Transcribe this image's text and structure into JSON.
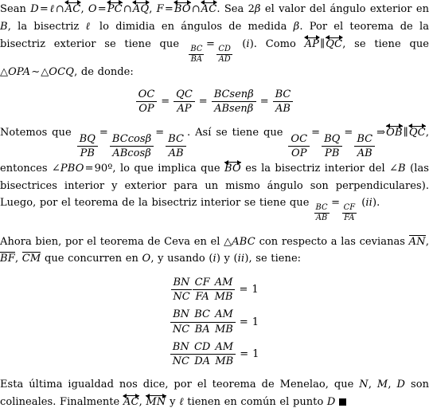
{
  "document": {
    "language": "es",
    "type": "math-proof",
    "paragraphs": [
      {
        "id": "p1",
        "segments": [
          {
            "t": "text",
            "v": "Sean "
          },
          {
            "t": "mi",
            "v": "D"
          },
          {
            "t": "op",
            "v": "="
          },
          {
            "t": "mi",
            "v": "ℓ"
          },
          {
            "t": "op",
            "v": "∩"
          },
          {
            "t": "line",
            "v": "AC"
          },
          {
            "t": "text",
            "v": ", "
          },
          {
            "t": "mi",
            "v": "O"
          },
          {
            "t": "op",
            "v": "="
          },
          {
            "t": "line",
            "v": "PC"
          },
          {
            "t": "op",
            "v": "∩"
          },
          {
            "t": "line",
            "v": "AQ"
          },
          {
            "t": "text",
            "v": ", "
          },
          {
            "t": "mi",
            "v": "F"
          },
          {
            "t": "op",
            "v": "="
          },
          {
            "t": "line",
            "v": "BO"
          },
          {
            "t": "op",
            "v": "∩"
          },
          {
            "t": "line",
            "v": "AC"
          },
          {
            "t": "text",
            "v": ". Sea 2"
          },
          {
            "t": "mi",
            "v": "β"
          },
          {
            "t": "text",
            "v": " el valor del ángulo exterior en "
          },
          {
            "t": "mi",
            "v": "B"
          },
          {
            "t": "text",
            "v": ", la bisectriz "
          },
          {
            "t": "mi",
            "v": "ℓ"
          },
          {
            "t": "text",
            "v": " lo dimidia en ángulos de medida "
          },
          {
            "t": "mi",
            "v": "β"
          },
          {
            "t": "text",
            "v": ". Por el teorema de la bisectriz exterior se tiene que "
          },
          {
            "t": "fracin",
            "num": "BC",
            "den": "BA"
          },
          {
            "t": "op",
            "v": "="
          },
          {
            "t": "fracin",
            "num": "CD",
            "den": "AD"
          },
          {
            "t": "text",
            "v": " ("
          },
          {
            "t": "mi",
            "v": "i"
          },
          {
            "t": "text",
            "v": "). Como "
          },
          {
            "t": "line",
            "v": "AP"
          },
          {
            "t": "op",
            "v": "∥"
          },
          {
            "t": "line",
            "v": "QC"
          },
          {
            "t": "text",
            "v": ", se tiene que △"
          },
          {
            "t": "mi",
            "v": "OPA"
          },
          {
            "t": "op",
            "v": "∼"
          },
          {
            "t": "text",
            "v": "△"
          },
          {
            "t": "mi",
            "v": "OCQ"
          },
          {
            "t": "text",
            "v": ", de donde:"
          }
        ]
      },
      {
        "id": "p3",
        "segments": [
          {
            "t": "text",
            "v": "Notemos que "
          },
          {
            "t": "frac",
            "num": "BQ",
            "den": "PB"
          },
          {
            "t": "op",
            "v": "="
          },
          {
            "t": "frac",
            "num": "BCcosβ",
            "den": "ABcosβ"
          },
          {
            "t": "op",
            "v": "="
          },
          {
            "t": "frac",
            "num": "BC",
            "den": "AB"
          },
          {
            "t": "text",
            "v": ". Así se tiene que "
          },
          {
            "t": "frac",
            "num": "OC",
            "den": "OP"
          },
          {
            "t": "op",
            "v": "="
          },
          {
            "t": "frac",
            "num": "BQ",
            "den": "PB"
          },
          {
            "t": "op",
            "v": "="
          },
          {
            "t": "frac",
            "num": "BC",
            "den": "AB"
          },
          {
            "t": "op",
            "v": "⇒"
          },
          {
            "t": "line",
            "v": "OB"
          },
          {
            "t": "op",
            "v": "∥"
          },
          {
            "t": "line",
            "v": "QC"
          },
          {
            "t": "text",
            "v": ", entonces ∠"
          },
          {
            "t": "mi",
            "v": "PBO"
          },
          {
            "t": "op",
            "v": "="
          },
          {
            "t": "text",
            "v": "90º, lo que implica que "
          },
          {
            "t": "line",
            "v": "BO"
          },
          {
            "t": "text",
            "v": " es la bisectriz interior del ∠"
          },
          {
            "t": "mi",
            "v": "B"
          },
          {
            "t": "text",
            "v": " (las bisectrices interior y exterior para un mismo ángulo son perpendiculares). Luego, por el teorema de la bisectriz interior se tiene que "
          },
          {
            "t": "fracin",
            "num": "BC",
            "den": "AB"
          },
          {
            "t": "op",
            "v": "="
          },
          {
            "t": "fracin",
            "num": "CF",
            "den": "FA"
          },
          {
            "t": "text",
            "v": " ("
          },
          {
            "t": "mi",
            "v": "ii"
          },
          {
            "t": "text",
            "v": ")."
          }
        ]
      },
      {
        "id": "p4",
        "segments": [
          {
            "t": "text",
            "v": "Ahora bien, por el teorema de Ceva en el △"
          },
          {
            "t": "mi",
            "v": "ABC"
          },
          {
            "t": "text",
            "v": " con respecto a las cevianas "
          },
          {
            "t": "seg",
            "v": "AN"
          },
          {
            "t": "text",
            "v": ", "
          },
          {
            "t": "seg",
            "v": "BF"
          },
          {
            "t": "text",
            "v": ", "
          },
          {
            "t": "seg",
            "v": "CM"
          },
          {
            "t": "text",
            "v": " que concurren en "
          },
          {
            "t": "mi",
            "v": "O"
          },
          {
            "t": "text",
            "v": ", y usando ("
          },
          {
            "t": "mi",
            "v": "i"
          },
          {
            "t": "text",
            "v": ") y ("
          },
          {
            "t": "mi",
            "v": "ii"
          },
          {
            "t": "text",
            "v": "), se tiene:"
          }
        ]
      },
      {
        "id": "p5",
        "segments": [
          {
            "t": "text",
            "v": "Esta última igualdad nos dice, por el teorema de Menelao, que "
          },
          {
            "t": "mi",
            "v": "N"
          },
          {
            "t": "text",
            "v": ", "
          },
          {
            "t": "mi",
            "v": "M"
          },
          {
            "t": "text",
            "v": ", "
          },
          {
            "t": "mi",
            "v": "D"
          },
          {
            "t": "text",
            "v": " son colineales. Finalmente "
          },
          {
            "t": "line",
            "v": "AC"
          },
          {
            "t": "text",
            "v": ", "
          },
          {
            "t": "line",
            "v": "MN"
          },
          {
            "t": "text",
            "v": " y "
          },
          {
            "t": "mi",
            "v": "ℓ"
          },
          {
            "t": "text",
            "v": " tienen en común el punto "
          },
          {
            "t": "mi",
            "v": "D"
          },
          {
            "t": "qed",
            "v": "■"
          }
        ]
      }
    ],
    "display_equations": [
      {
        "id": "eq1",
        "parts": [
          {
            "t": "frac",
            "num": "OC",
            "den": "OP"
          },
          {
            "t": "op",
            "v": "="
          },
          {
            "t": "frac",
            "num": "QC",
            "den": "AP"
          },
          {
            "t": "op",
            "v": "="
          },
          {
            "t": "frac",
            "num": "BCsenβ",
            "den": "ABsenβ"
          },
          {
            "t": "op",
            "v": "="
          },
          {
            "t": "frac",
            "num": "BC",
            "den": "AB"
          }
        ]
      },
      {
        "id": "eq2",
        "parts": [
          {
            "t": "frac",
            "num": "BN",
            "den": "NC"
          },
          {
            "t": "frac",
            "num": "CF",
            "den": "FA"
          },
          {
            "t": "frac",
            "num": "AM",
            "den": "MB"
          },
          {
            "t": "op",
            "v": "="
          },
          {
            "t": "mn",
            "v": "1"
          }
        ]
      },
      {
        "id": "eq3",
        "parts": [
          {
            "t": "frac",
            "num": "BN",
            "den": "NC"
          },
          {
            "t": "frac",
            "num": "BC",
            "den": "BA"
          },
          {
            "t": "frac",
            "num": "AM",
            "den": "MB"
          },
          {
            "t": "op",
            "v": "="
          },
          {
            "t": "mn",
            "v": "1"
          }
        ]
      },
      {
        "id": "eq4",
        "parts": [
          {
            "t": "frac",
            "num": "BN",
            "den": "NC"
          },
          {
            "t": "frac",
            "num": "CD",
            "den": "DA"
          },
          {
            "t": "frac",
            "num": "AM",
            "den": "MB"
          },
          {
            "t": "op",
            "v": "="
          },
          {
            "t": "mn",
            "v": "1"
          }
        ]
      }
    ]
  }
}
